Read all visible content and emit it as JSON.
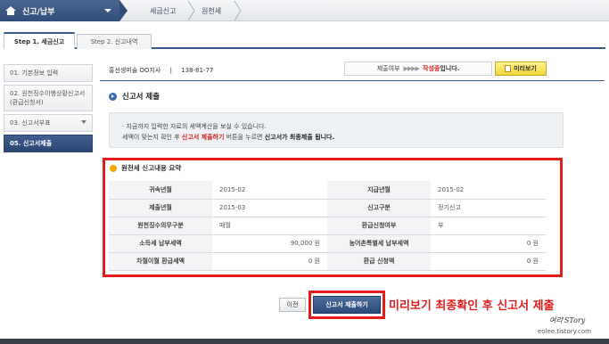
{
  "breadcrumb": {
    "menu_label": "신고/납부",
    "items": [
      "세금신고",
      "원천세"
    ]
  },
  "tabs": [
    {
      "label": "Step 1. 세금신고",
      "active": true
    },
    {
      "label": "Step 2. 신고내역",
      "active": false
    }
  ],
  "steps": [
    {
      "label": "01.  기본정보 입력",
      "active": false
    },
    {
      "label": "02.  원천징수이행상황신고서(환급신청서)",
      "active": false
    },
    {
      "label": "03.  신고서부표",
      "active": false
    },
    {
      "label": "05.  신고서제출",
      "active": true
    }
  ],
  "taxpayer": {
    "name": "홍선생미술 OO지사",
    "separator": "|",
    "number": "138-81-77"
  },
  "status": {
    "prefix": "제출여부",
    "arrows": "▶▶▶▶",
    "state": "작성중",
    "suffix": "입니다."
  },
  "preview_button": {
    "label": "미리보기"
  },
  "section_title": "신고서 제출",
  "notice": {
    "line1": "· 지금까지 입력한 자료의 세액계산을 보실 수 있습니다.",
    "line2_a": "세액이 맞는지 확인 후 ",
    "line2_red": "신고서 제출하기",
    "line2_b": " 버튼을 누르면 ",
    "line2_bold": "신고서가 최종제출 됩니다."
  },
  "summary": {
    "title": "원천세 신고내용 요약",
    "rows": [
      {
        "l1": "귀속년월",
        "v1": "2015-02",
        "l2": "지급년월",
        "v2": "2015-02"
      },
      {
        "l1": "제출년월",
        "v1": "2015-03",
        "l2": "신고구분",
        "v2": "정기신고"
      },
      {
        "l1": "원천징수의무구분",
        "v1": "매월",
        "l2": "환급신청여부",
        "v2": "부"
      },
      {
        "l1": "소득세 납부세액",
        "v1": "90,000 원",
        "l2": "농어촌특별세 납부세액",
        "v2": "0 원"
      },
      {
        "l1": "차월이월 환급세액",
        "v1": "0 원",
        "l2": "환급 신청액",
        "v2": "0 원"
      }
    ]
  },
  "buttons": {
    "prev": "이전",
    "submit": "신고서 제출하기"
  },
  "annotation": "미리보기 최종확인 후 신고서 제출",
  "watermark": {
    "line1": "여리'STory",
    "line2": "eolee.tistory.com"
  },
  "colors": {
    "nav": "#2f4d78",
    "highlight": "#e21c1c",
    "status_red": "#d12020",
    "preview_yellow": "#f2d83a"
  }
}
